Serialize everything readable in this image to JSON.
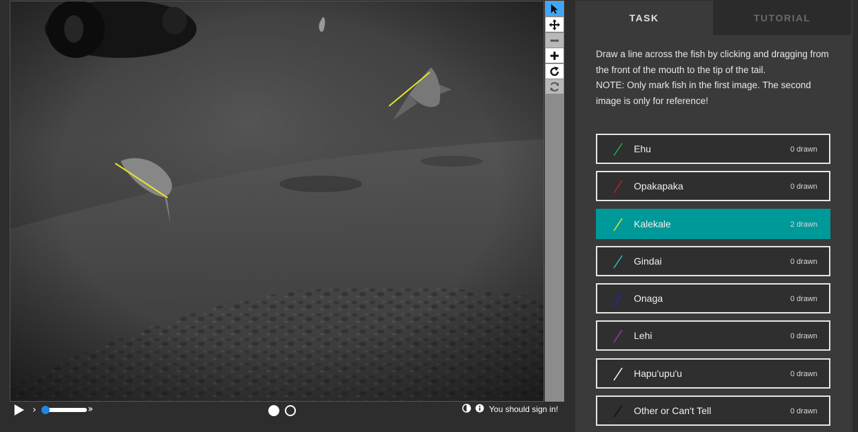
{
  "tabs": {
    "task": "TASK",
    "tutorial": "TUTORIAL"
  },
  "instructions": {
    "main": "Draw a line across the fish by clicking and dragging from the front of the mouth to the tip of the tail.",
    "note": "NOTE: Only mark fish in the first image. The second image is only for reference!"
  },
  "options": [
    {
      "label": "Ehu",
      "count": "0 drawn",
      "color": "#22b14c",
      "selected": false
    },
    {
      "label": "Opakapaka",
      "count": "0 drawn",
      "color": "#c0202a",
      "selected": false
    },
    {
      "label": "Kalekale",
      "count": "2 drawn",
      "color": "#e6e62a",
      "selected": true
    },
    {
      "label": "Gindai",
      "count": "0 drawn",
      "color": "#22c3c8",
      "selected": false
    },
    {
      "label": "Onaga",
      "count": "0 drawn",
      "color": "#1c28c8",
      "selected": false
    },
    {
      "label": "Lehi",
      "count": "0 drawn",
      "color": "#b428c0",
      "selected": false
    },
    {
      "label": "Hapu'upu'u",
      "count": "0 drawn",
      "color": "#ffffff",
      "selected": false
    },
    {
      "label": "Other or Can't Tell",
      "count": "0 drawn",
      "color": "#111111",
      "selected": false
    }
  ],
  "toolbar": {
    "tools": [
      {
        "name": "pointer-tool",
        "icon": "cursor-icon",
        "state": "active"
      },
      {
        "name": "move-tool",
        "icon": "move-arrows-icon",
        "state": "normal"
      },
      {
        "name": "zoom-out-button",
        "icon": "minus-icon",
        "state": "disabled"
      },
      {
        "name": "zoom-in-button",
        "icon": "plus-icon",
        "state": "normal"
      },
      {
        "name": "rotate-button",
        "icon": "rotate-icon",
        "state": "normal"
      },
      {
        "name": "reset-button",
        "icon": "refresh-icon",
        "state": "disabled"
      }
    ]
  },
  "controls": {
    "frames": 2,
    "current_frame": 1,
    "sign_in_text": "You should sign in!"
  },
  "colors": {
    "accent": "#009999",
    "panel": "#3a3a3a",
    "line_drawn": "#e6e62a",
    "active_tool": "#42a5f5"
  }
}
